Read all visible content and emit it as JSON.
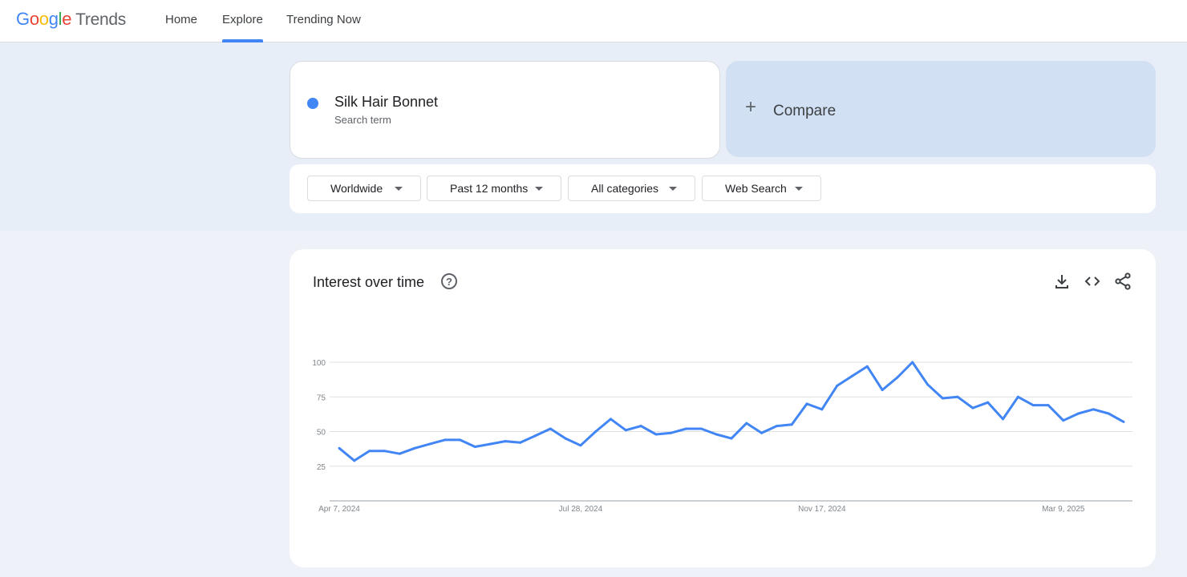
{
  "header": {
    "logo_google": [
      "G",
      "o",
      "o",
      "g",
      "l",
      "e"
    ],
    "logo_trends": "Trends",
    "nav": {
      "home": "Home",
      "explore": "Explore",
      "trending": "Trending Now"
    },
    "active_tab": "Explore"
  },
  "search": {
    "term": "Silk Hair Bonnet",
    "term_type": "Search term",
    "term_color": "#4285f4",
    "compare_label": "Compare"
  },
  "filters": {
    "region": "Worldwide",
    "time": "Past 12 months",
    "category": "All categories",
    "property": "Web Search"
  },
  "chart_section": {
    "title": "Interest over time",
    "help_icon": "help-circle-icon",
    "actions": [
      "download-icon",
      "embed-code-icon",
      "share-icon"
    ]
  },
  "chart_data": {
    "type": "line",
    "title": "Interest over time",
    "ylim": [
      0,
      100
    ],
    "y_ticks": [
      100,
      75,
      50,
      25
    ],
    "x_tick_labels": [
      "Apr 7, 2024",
      "Jul 28, 2024",
      "Nov 17, 2024",
      "Mar 9, 2025"
    ],
    "x_tick_indices": [
      0,
      16,
      32,
      48
    ],
    "grid": true,
    "series": [
      {
        "name": "Silk Hair Bonnet",
        "color": "#4285f4",
        "values": [
          38,
          29,
          36,
          36,
          34,
          38,
          41,
          44,
          44,
          39,
          41,
          43,
          42,
          47,
          52,
          45,
          40,
          50,
          59,
          51,
          54,
          48,
          49,
          52,
          52,
          48,
          45,
          56,
          49,
          54,
          55,
          70,
          66,
          83,
          90,
          97,
          80,
          89,
          100,
          84,
          74,
          75,
          67,
          71,
          59,
          75,
          69,
          69,
          58,
          63,
          66,
          63,
          57
        ]
      }
    ]
  }
}
